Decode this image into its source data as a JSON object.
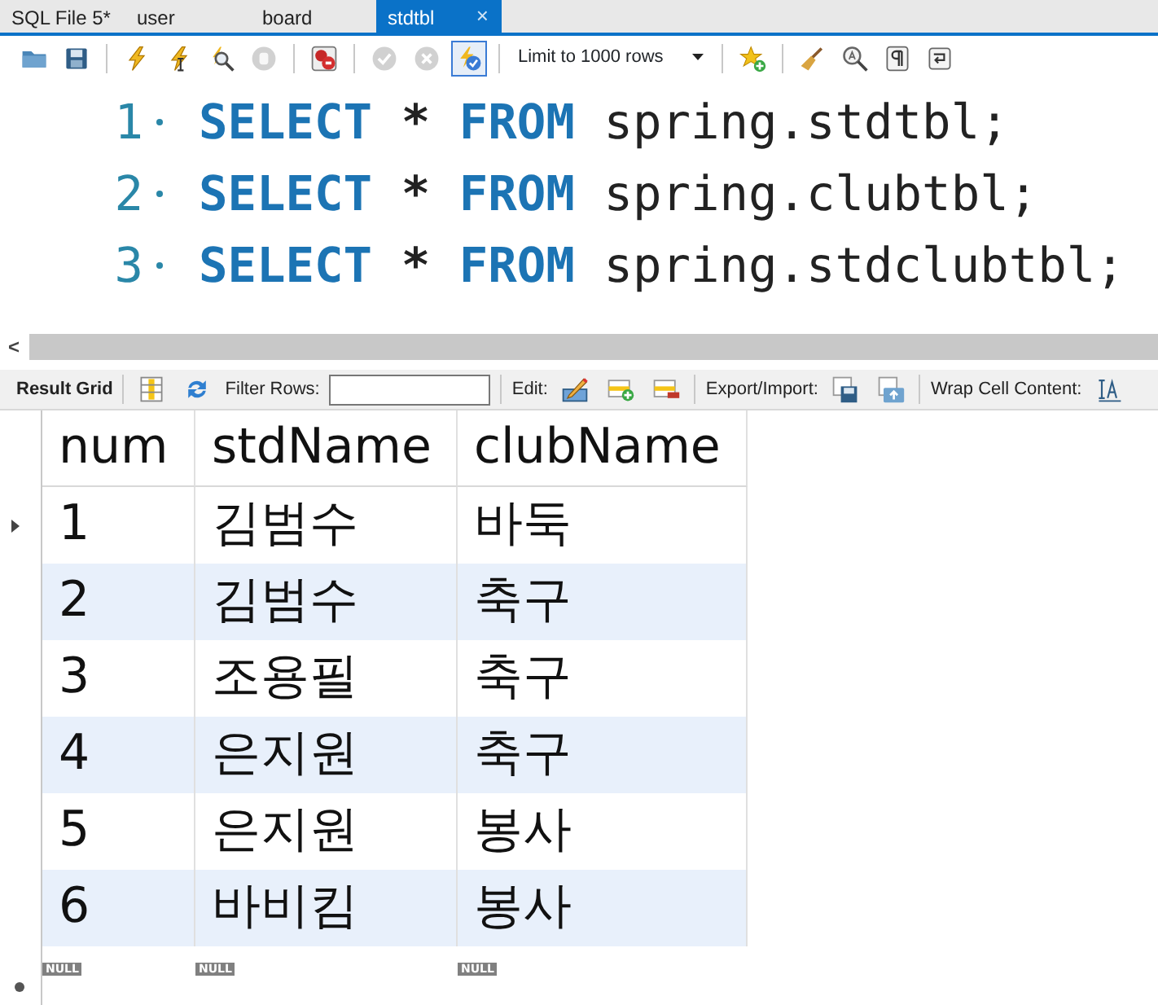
{
  "tabs": [
    {
      "label": "SQL File 5*",
      "selected": false
    },
    {
      "label": "user",
      "selected": false
    },
    {
      "label": "board",
      "selected": false
    },
    {
      "label": "stdtbl",
      "selected": true,
      "close": "×"
    }
  ],
  "toolbar": [
    {
      "kind": "folder",
      "disabled": false,
      "on": false
    },
    {
      "kind": "save",
      "disabled": false,
      "on": false
    },
    {
      "kind": "separator"
    },
    {
      "kind": "bolt",
      "disabled": false,
      "on": false
    },
    {
      "kind": "bolt-cursor",
      "disabled": false,
      "on": false
    },
    {
      "kind": "magnifier",
      "disabled": false,
      "on": false
    },
    {
      "kind": "hand",
      "disabled": true,
      "on": false
    },
    {
      "kind": "separator"
    },
    {
      "kind": "stop",
      "disabled": false,
      "on": false
    },
    {
      "kind": "separator"
    },
    {
      "kind": "check",
      "disabled": true,
      "on": false
    },
    {
      "kind": "cross",
      "disabled": true,
      "on": false
    },
    {
      "kind": "autocommit",
      "disabled": false,
      "on": true
    },
    {
      "kind": "separator"
    },
    {
      "kind": "limit",
      "value": "Limit to 1000 rows"
    },
    {
      "kind": "separator"
    },
    {
      "kind": "star",
      "disabled": false,
      "on": false
    },
    {
      "kind": "separator"
    },
    {
      "kind": "broom",
      "disabled": false,
      "on": false
    },
    {
      "kind": "find",
      "disabled": false,
      "on": false
    },
    {
      "kind": "pilcrow",
      "disabled": false,
      "on": false
    },
    {
      "kind": "wrap",
      "disabled": false,
      "on": false
    }
  ],
  "editor": {
    "lines": [
      {
        "number": "1",
        "tokens": [
          {
            "text": "SELECT",
            "kind": "keyword"
          },
          {
            "text": "*",
            "kind": "operator"
          },
          {
            "text": "FROM",
            "kind": "keyword"
          },
          {
            "text": "spring.stdtbl;",
            "kind": "plain"
          }
        ]
      },
      {
        "number": "2",
        "tokens": [
          {
            "text": "SELECT",
            "kind": "keyword"
          },
          {
            "text": "*",
            "kind": "operator"
          },
          {
            "text": "FROM",
            "kind": "keyword"
          },
          {
            "text": "spring.clubtbl;",
            "kind": "plain"
          }
        ]
      },
      {
        "number": "3",
        "tokens": [
          {
            "text": "SELECT",
            "kind": "keyword"
          },
          {
            "text": "*",
            "kind": "operator"
          },
          {
            "text": "FROM",
            "kind": "keyword"
          },
          {
            "text": "spring.stdclubtbl;",
            "kind": "plain"
          }
        ]
      }
    ]
  },
  "scrollbar": {
    "arrow": "<"
  },
  "result_toolbar": [
    {
      "kind": "title",
      "text": "Result Grid"
    },
    {
      "kind": "separator"
    },
    {
      "kind": "columns"
    },
    {
      "kind": "refresh"
    },
    {
      "kind": "label",
      "text": "Filter Rows:"
    },
    {
      "kind": "field"
    },
    {
      "kind": "separator"
    },
    {
      "kind": "label",
      "text": "Edit:"
    },
    {
      "kind": "pencil"
    },
    {
      "kind": "row-add"
    },
    {
      "kind": "row-delete"
    },
    {
      "kind": "separator"
    },
    {
      "kind": "label",
      "text": "Export/Import:"
    },
    {
      "kind": "export"
    },
    {
      "kind": "import"
    },
    {
      "kind": "separator"
    },
    {
      "kind": "label",
      "text": "Wrap Cell Content:"
    },
    {
      "kind": "wrap-cell"
    }
  ],
  "grid": {
    "columns": [
      "num",
      "stdName",
      "clubName"
    ],
    "rows": [
      {
        "cells": [
          "1",
          "김범수",
          "바둑"
        ],
        "current": true
      },
      {
        "cells": [
          "2",
          "김범수",
          "축구"
        ],
        "current": false
      },
      {
        "cells": [
          "3",
          "조용필",
          "축구"
        ],
        "current": false
      },
      {
        "cells": [
          "4",
          "은지원",
          "축구"
        ],
        "current": false
      },
      {
        "cells": [
          "5",
          "은지원",
          "봉사"
        ],
        "current": false
      },
      {
        "cells": [
          "6",
          "바비킴",
          "봉사"
        ],
        "current": false
      }
    ],
    "new_row": {
      "cells": [
        "NULL",
        "NULL",
        "NULL"
      ]
    }
  }
}
